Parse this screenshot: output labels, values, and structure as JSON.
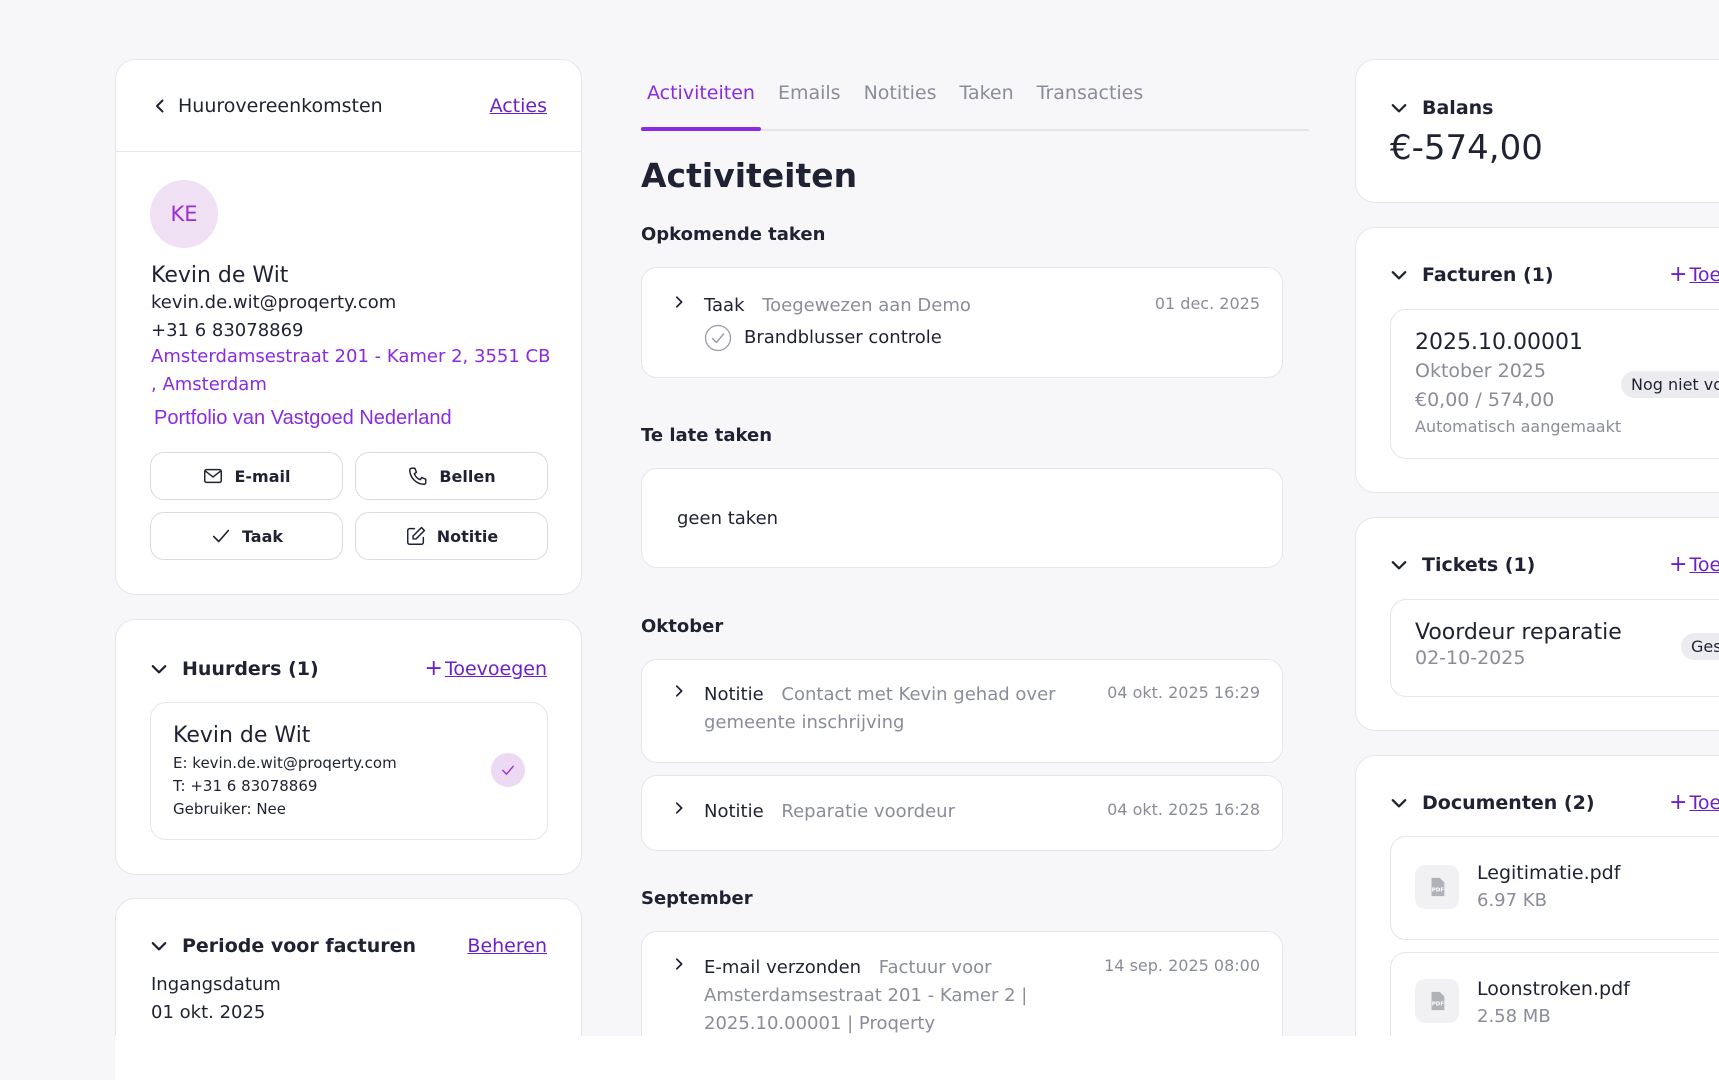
{
  "contact": {
    "back_label": "Huurovereenkomsten",
    "actions_label": "Acties",
    "initials": "KE",
    "name": "Kevin de Wit",
    "email": "kevin.de.wit@proqerty.com",
    "phone": "+31 6 83078869",
    "address": "Amsterdamsestraat 201 - Kamer 2, 3551 CB , Amsterdam",
    "portfolio": "Portfolio van Vastgoed Nederland",
    "buttons": {
      "email": "E-mail",
      "call": "Bellen",
      "task": "Taak",
      "note": "Notitie"
    }
  },
  "huurders": {
    "title": "Huurders (1)",
    "add_label": "Toevoegen",
    "tenant": {
      "name": "Kevin de Wit",
      "email_line": "E: kevin.de.wit@proqerty.com",
      "phone_line": "T: +31 6 83078869",
      "user_line": "Gebruiker: Nee"
    }
  },
  "periode": {
    "title": "Periode voor facturen",
    "manage_label": "Beheren",
    "start_label": "Ingangsdatum",
    "start_value": "01 okt. 2025"
  },
  "tabs": [
    "Activiteiten",
    "Emails",
    "Notities",
    "Taken",
    "Transacties"
  ],
  "active_tab": "Activiteiten",
  "activities": {
    "heading": "Activiteiten",
    "upcoming_title": "Opkomende taken",
    "upcoming_task": {
      "type": "Taak",
      "assigned": "Toegewezen aan Demo",
      "date": "01 dec. 2025",
      "title": "Brandblusser controle"
    },
    "late_title": "Te late taken",
    "late_empty": "geen taken",
    "october_title": "Oktober",
    "october_items": [
      {
        "type": "Notitie",
        "desc": "Contact met Kevin gehad over gemeente inschrijving",
        "date": "04 okt. 2025 16:29"
      },
      {
        "type": "Notitie",
        "desc": "Reparatie voordeur",
        "date": "04 okt. 2025 16:28"
      }
    ],
    "september_title": "September",
    "september_items": [
      {
        "type": "E-mail verzonden",
        "desc": "Factuur voor Amsterdamsestraat 201 - Kamer 2 | 2025.10.00001 | Proqerty",
        "date": "14 sep. 2025 08:00"
      }
    ]
  },
  "balans": {
    "title": "Balans",
    "amount": "€-574,00"
  },
  "facturen": {
    "title": "Facturen (1)",
    "add_label": "Toe",
    "invoice": {
      "number": "2025.10.00001",
      "period": "Oktober 2025",
      "amount": "€0,00 / 574,00",
      "note": "Automatisch aangemaakt",
      "status": "Nog niet vo"
    }
  },
  "tickets": {
    "title": "Tickets (1)",
    "add_label": "Toe",
    "ticket": {
      "title": "Voordeur reparatie",
      "date": "02-10-2025",
      "status": "Ges"
    }
  },
  "documenten": {
    "title": "Documenten (2)",
    "add_label": "Toe",
    "items": [
      {
        "name": "Legitimatie.pdf",
        "size": "6.97 KB"
      },
      {
        "name": "Loonstroken.pdf",
        "size": "2.58 MB"
      }
    ]
  },
  "colors": {
    "accent": "#8a2be2",
    "link": "#6d1fc9",
    "text": "#1f2233",
    "muted": "#8a8d99"
  }
}
